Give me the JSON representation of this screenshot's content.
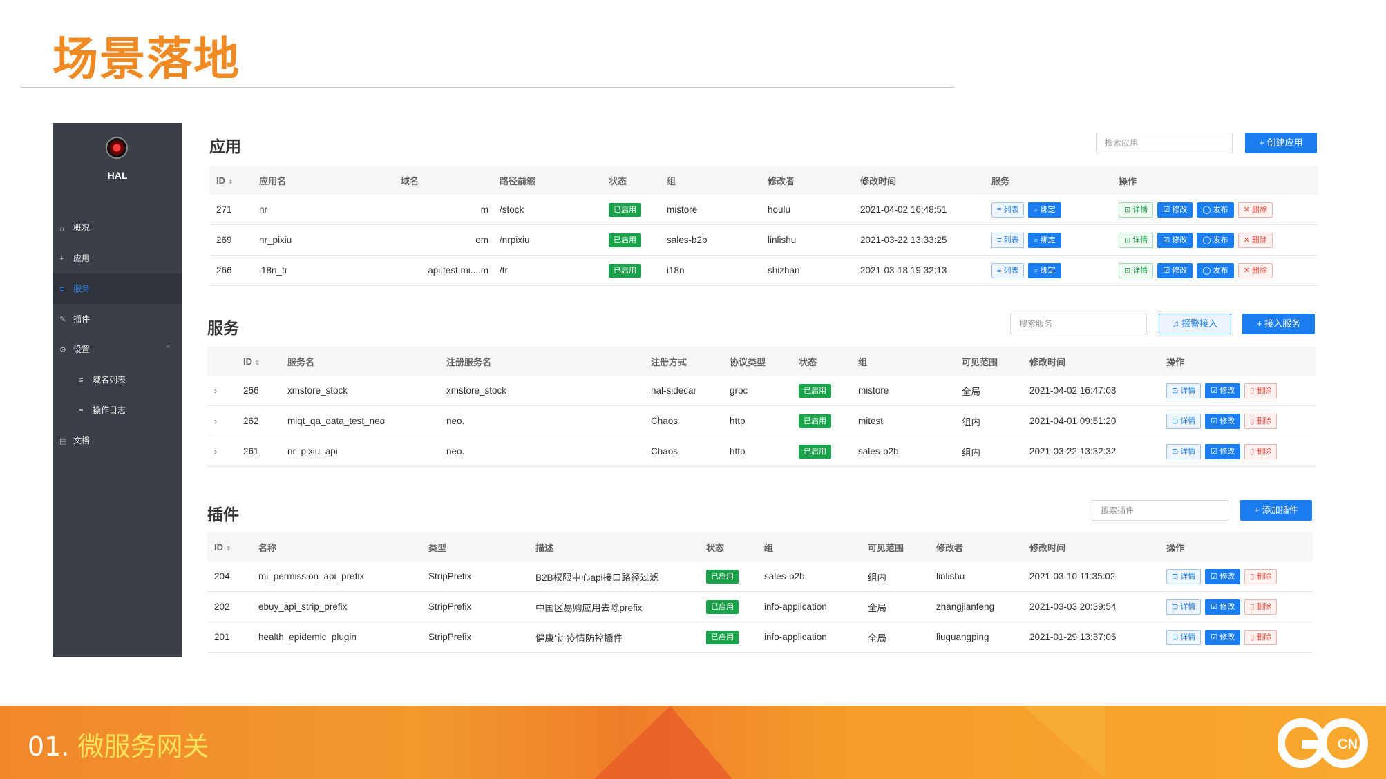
{
  "slide": {
    "title": "场景落地",
    "footer_number": "01.",
    "footer_label": "微服务网关",
    "logo_text": "GO",
    "logo_sub": "CN"
  },
  "sidebar": {
    "brand": "HAL",
    "items": [
      {
        "label": "概况",
        "icon": "home-icon"
      },
      {
        "label": "应用",
        "icon": "plus-icon"
      },
      {
        "label": "服务",
        "icon": "list-icon"
      },
      {
        "label": "插件",
        "icon": "pencil-icon"
      },
      {
        "label": "设置",
        "icon": "gear-icon"
      },
      {
        "label": "域名列表",
        "icon": "list-icon"
      },
      {
        "label": "操作日志",
        "icon": "list-icon"
      },
      {
        "label": "文档",
        "icon": "doc-icon"
      }
    ]
  },
  "apps": {
    "title": "应用",
    "search_placeholder": "搜索应用",
    "create_label": "+ 创建应用",
    "columns": [
      "ID",
      "应用名",
      "域名",
      "路径前缀",
      "状态",
      "组",
      "修改者",
      "修改时间",
      "服务",
      "操作"
    ],
    "rows": [
      {
        "id": "271",
        "name": "nr",
        "domain": "m",
        "path": "/stock",
        "status": "已启用",
        "group": "mistore",
        "modifier": "houlu",
        "time": "2021-04-02 16:48:51"
      },
      {
        "id": "269",
        "name": "nr_pixiu",
        "domain": "om",
        "path": "/nrpixiu",
        "status": "已启用",
        "group": "sales-b2b",
        "modifier": "linlishu",
        "time": "2021-03-22 13:33:25"
      },
      {
        "id": "266",
        "name": "i18n_tr",
        "domain": "api.test.mi....m",
        "path": "/tr",
        "status": "已启用",
        "group": "i18n",
        "modifier": "shizhan",
        "time": "2021-03-18 19:32:13"
      }
    ],
    "service_actions": [
      "≡ 列表",
      "⌕ 绑定"
    ],
    "actions": [
      "⊡ 详情",
      "☑ 修改",
      "◯ 发布",
      "✕ 删除"
    ]
  },
  "services": {
    "title": "服务",
    "search_placeholder": "搜索服务",
    "alert_label": "♫ 报警接入",
    "add_label": "+ 接入服务",
    "columns": [
      "ID",
      "服务名",
      "注册服务名",
      "注册方式",
      "协议类型",
      "状态",
      "组",
      "可见范围",
      "修改时间",
      "操作"
    ],
    "rows": [
      {
        "id": "266",
        "name": "xmstore_stock",
        "reg_name": "xmstore_stock",
        "reg_type": "hal-sidecar",
        "protocol": "grpc",
        "status": "已启用",
        "group": "mistore",
        "scope": "全局",
        "time": "2021-04-02 16:47:08"
      },
      {
        "id": "262",
        "name": "miqt_qa_data_test_neo",
        "reg_name": "neo.",
        "reg_type": "Chaos",
        "protocol": "http",
        "status": "已启用",
        "group": "mitest",
        "scope": "组内",
        "time": "2021-04-01 09:51:20"
      },
      {
        "id": "261",
        "name": "nr_pixiu_api",
        "reg_name": "neo.",
        "reg_type": "Chaos",
        "protocol": "http",
        "status": "已启用",
        "group": "sales-b2b",
        "scope": "组内",
        "time": "2021-03-22 13:32:32"
      }
    ],
    "actions": [
      "⊡ 详情",
      "☑ 修改",
      "▯ 删除"
    ]
  },
  "plugins": {
    "title": "插件",
    "search_placeholder": "搜索插件",
    "add_label": "+ 添加插件",
    "columns": [
      "ID",
      "名称",
      "类型",
      "描述",
      "状态",
      "组",
      "可见范围",
      "修改者",
      "修改时间",
      "操作"
    ],
    "rows": [
      {
        "id": "204",
        "name": "mi_permission_api_prefix",
        "type": "StripPrefix",
        "desc": "B2B权限中心api接口路径过滤",
        "status": "已启用",
        "group": "sales-b2b",
        "scope": "组内",
        "modifier": "linlishu",
        "time": "2021-03-10 11:35:02"
      },
      {
        "id": "202",
        "name": "ebuy_api_strip_prefix",
        "type": "StripPrefix",
        "desc": "中国区易购应用去除prefix",
        "status": "已启用",
        "group": "info-application",
        "scope": "全局",
        "modifier": "zhangjianfeng",
        "time": "2021-03-03 20:39:54"
      },
      {
        "id": "201",
        "name": "health_epidemic_plugin",
        "type": "StripPrefix",
        "desc": "健康宝-疫情防控插件",
        "status": "已启用",
        "group": "info-application",
        "scope": "全局",
        "modifier": "liuguangping",
        "time": "2021-01-29 13:37:05"
      }
    ],
    "actions": [
      "⊡ 详情",
      "☑ 修改",
      "▯ 删除"
    ]
  }
}
